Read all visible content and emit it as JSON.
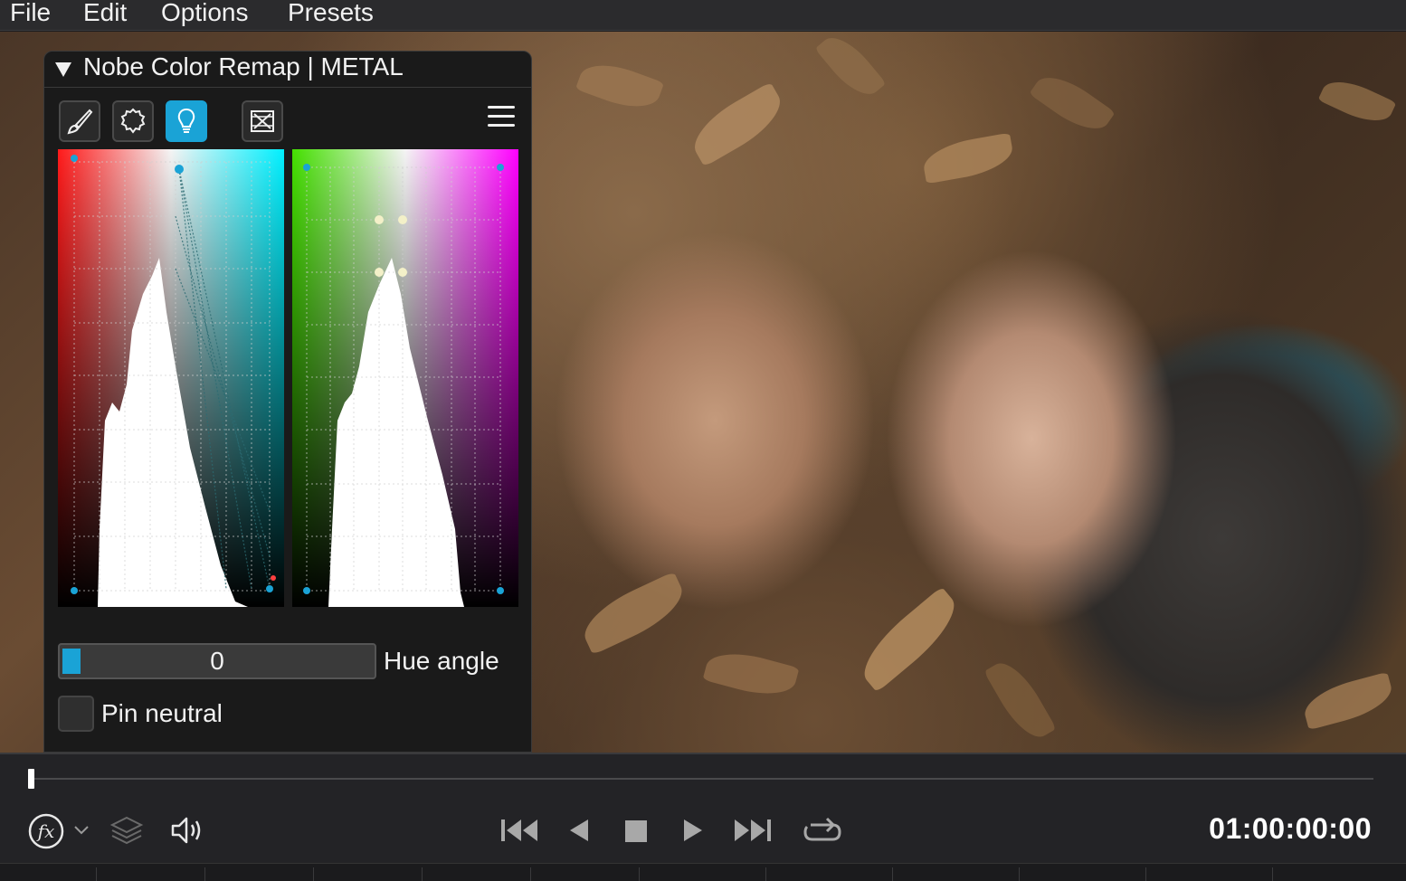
{
  "menu": {
    "items": [
      "File",
      "Edit",
      "Options",
      "Presets"
    ]
  },
  "panel": {
    "title": "Nobe Color Remap | METAL",
    "tools": [
      {
        "name": "brush-icon",
        "active": false
      },
      {
        "name": "circle-selection-icon",
        "active": false
      },
      {
        "name": "lightbulb-icon",
        "active": true
      },
      {
        "name": "reset-grid-icon",
        "active": false
      }
    ],
    "menu_icon": "hamburger-menu-icon",
    "hue_angle": {
      "value": "0",
      "label": "Hue angle",
      "level": 0
    },
    "pin_neutral": {
      "label": "Pin neutral",
      "checked": false
    }
  },
  "graphs": {
    "left": {
      "gradient": "red-to-cyan",
      "colors": [
        "#ff1a1a",
        "#ffffff",
        "#00f0ff"
      ]
    },
    "right": {
      "gradient": "green-to-magenta",
      "colors": [
        "#44e000",
        "#ffffff",
        "#ff00ff"
      ]
    }
  },
  "transport": {
    "fx_icon": "fx-icon",
    "chevron_icon": "chevron-down-icon",
    "layers_icon": "layers-icon",
    "audio_icon": "speaker-icon",
    "skip_start_icon": "skip-to-start-icon",
    "prev_icon": "step-back-icon",
    "stop_icon": "stop-icon",
    "play_icon": "play-icon",
    "skip_end_icon": "skip-to-end-icon",
    "loop_icon": "loop-icon",
    "timecode": "01:00:00:00",
    "playhead_position": 0
  },
  "colors": {
    "accent": "#1aa3d6",
    "panel_bg": "#1a1a1a",
    "menubar_bg": "#2b2b2d"
  }
}
